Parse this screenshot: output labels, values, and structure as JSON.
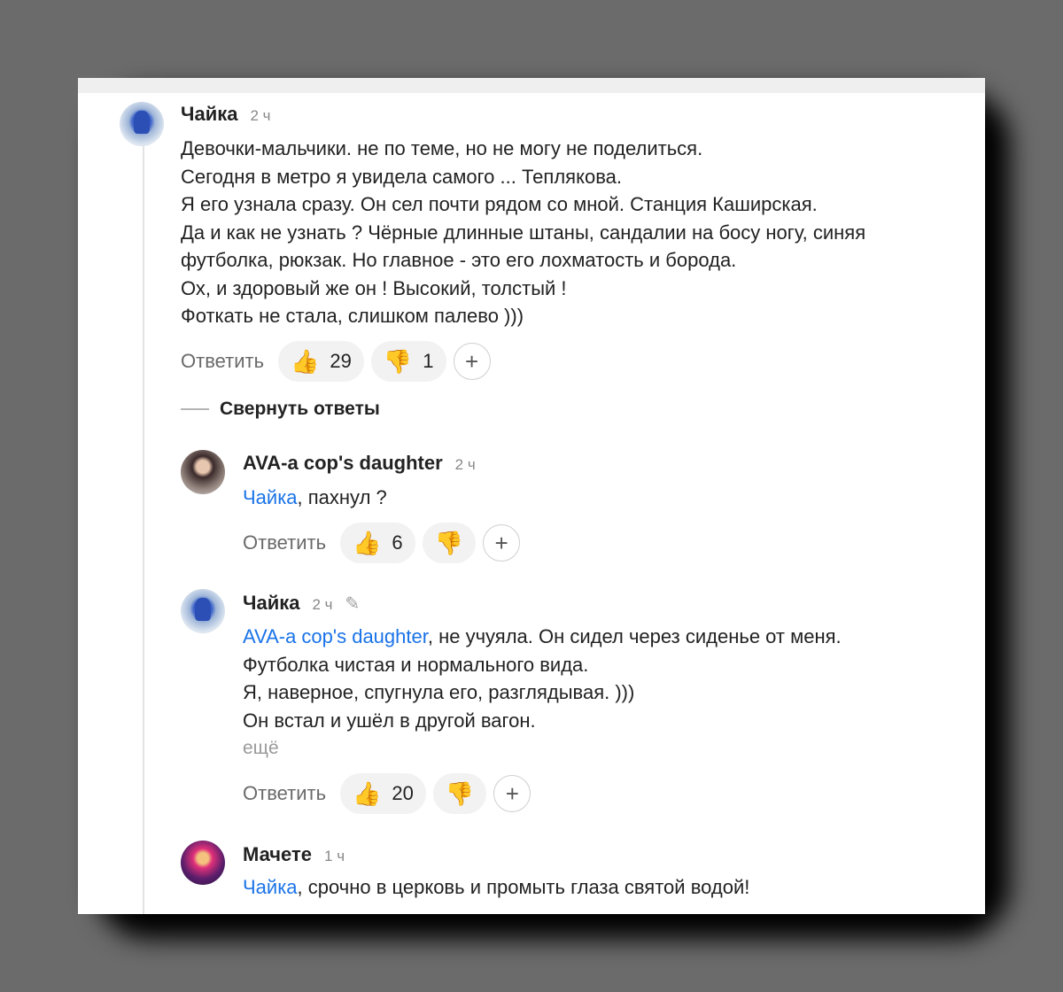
{
  "reply_label": "Ответить",
  "collapse_label": "Свернуть ответы",
  "comments": [
    {
      "author": "Чайка",
      "time": "2 ч",
      "lines": [
        "Девочки-мальчики. не по теме, но не могу не поделиться.",
        "Сегодня в метро я увидела самого ... Теплякова.",
        "Я его узнала сразу. Он сел почти рядом со мной. Станция Каширская.",
        "Да и как не узнать ? Чёрные длинные штаны, сандалии на босу ногу, синяя",
        "футболка, рюкзак. Но главное - это его лохматость и борода.",
        "Ох, и здоровый же он ! Высокий, толстый !",
        "Фоткать не стала, слишком палево )))"
      ],
      "likes": "29",
      "dislikes": "1"
    },
    {
      "author": "AVA-a cop's daughter",
      "time": "2 ч",
      "mention": "Чайка",
      "text_after_mention": ", пахнул ?",
      "likes": "6"
    },
    {
      "author": "Чайка",
      "time": "2 ч",
      "mention": "AVA-a cop's daughter",
      "text_after_mention": ", не учуяла. Он сидел через сиденье от меня.",
      "lines": [
        "Футболка чистая и нормального вида.",
        "Я, наверное, спугнула его, разглядывая. )))",
        "Он встал и ушёл в другой вагон."
      ],
      "more_label": "ещё",
      "likes": "20"
    },
    {
      "author": "Мачете",
      "time": "1 ч",
      "mention": "Чайка",
      "text_after_mention": ", срочно в церковь и промыть глаза святой водой!"
    }
  ],
  "icons": {
    "like": "👍",
    "dislike": "👎",
    "add": "+",
    "edit": "pencil-icon"
  },
  "colors": {
    "mention": "#1a73e8",
    "secondary_text": "#6a6a6a",
    "reaction_bg": "#f2f2f2"
  }
}
